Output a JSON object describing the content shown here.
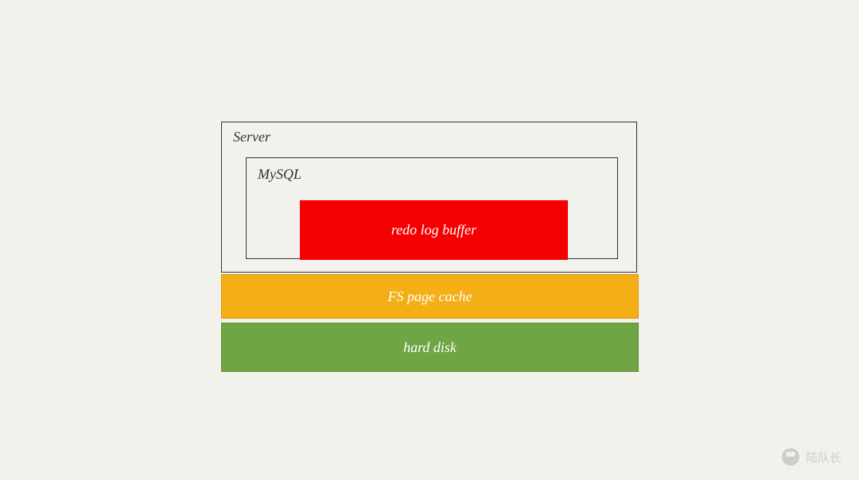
{
  "diagram": {
    "server": {
      "label": "Server",
      "mysql": {
        "label": "MySQL",
        "redoLogBuffer": {
          "label": "redo log buffer",
          "color": "#f40000"
        }
      }
    },
    "fsPageCache": {
      "label": "FS page cache",
      "color": "#f3af15"
    },
    "hardDisk": {
      "label": "hard disk",
      "color": "#6fa543"
    }
  },
  "watermark": {
    "text": "陆队长"
  }
}
